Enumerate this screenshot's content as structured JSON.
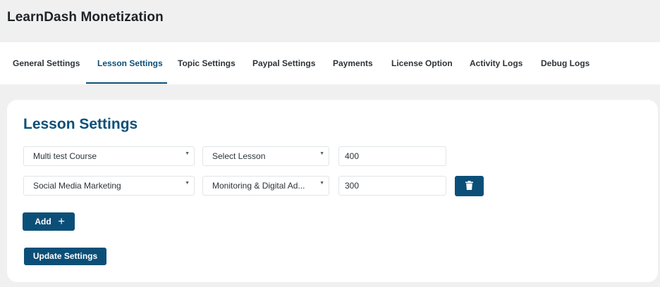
{
  "header": {
    "title": "LearnDash Monetization"
  },
  "tabs": [
    {
      "label": "General Settings",
      "active": false
    },
    {
      "label": "Lesson Settings",
      "active": true
    },
    {
      "label": "Topic Settings",
      "active": false
    },
    {
      "label": "Paypal Settings",
      "active": false
    },
    {
      "label": "Payments",
      "active": false
    },
    {
      "label": "License Option",
      "active": false
    },
    {
      "label": "Activity Logs",
      "active": false
    },
    {
      "label": "Debug Logs",
      "active": false
    }
  ],
  "panel": {
    "title": "Lesson Settings",
    "rows": [
      {
        "course": "Multi test Course",
        "lesson": "Select Lesson",
        "amount": "400",
        "deletable": false
      },
      {
        "course": "Social Media Marketing",
        "lesson": "Monitoring & Digital Ad...",
        "amount": "300",
        "deletable": true
      }
    ],
    "add_label": "Add",
    "add_icon": "+",
    "update_label": "Update Settings",
    "delete_icon": "trash-icon"
  },
  "colors": {
    "accent": "#0b4f78",
    "page_bg": "#f0f0f0",
    "card_bg": "#ffffff"
  }
}
